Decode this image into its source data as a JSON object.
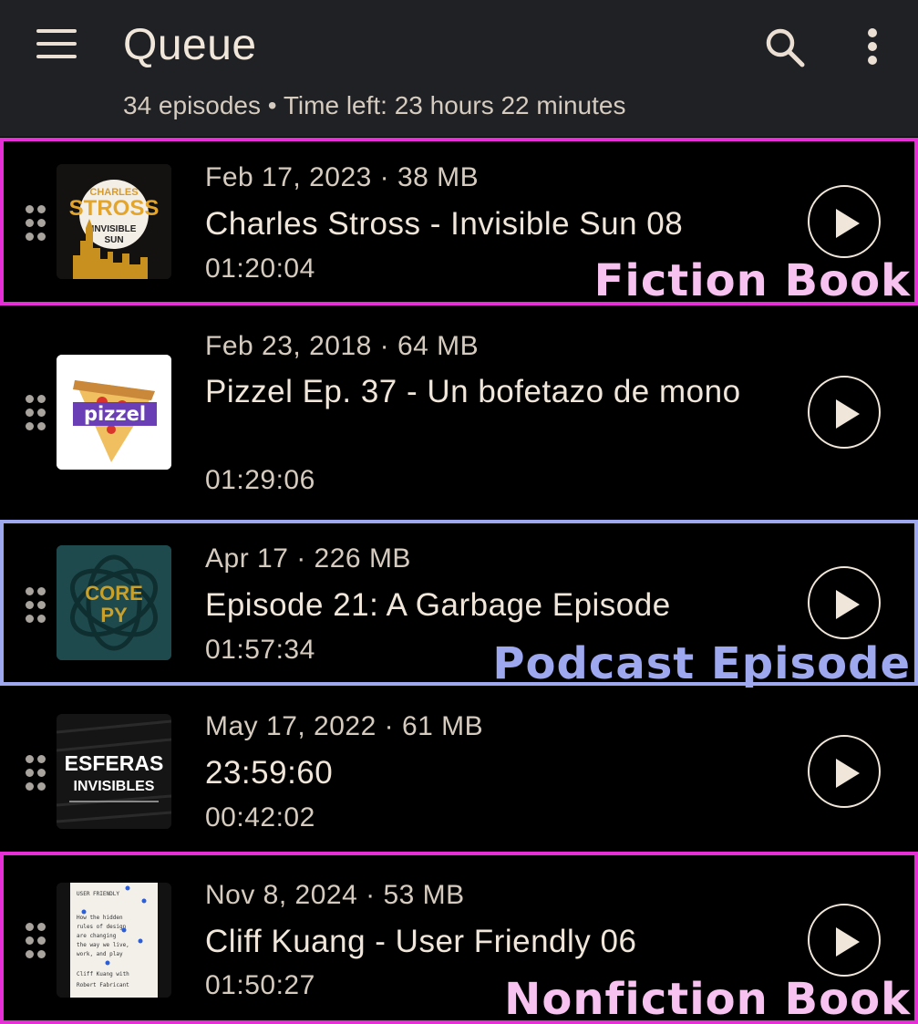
{
  "header": {
    "title": "Queue",
    "summary": "34 episodes • Time left: 23 hours 22 minutes"
  },
  "icons": {
    "menu": "hamburger-menu-icon",
    "search": "search-icon",
    "more": "more-vertical-icon",
    "drag": "drag-handle-icon",
    "play": "play-icon"
  },
  "episodes": [
    {
      "meta": "Feb 17, 2023 · 38 MB",
      "title": "Charles Stross - Invisible Sun 08",
      "duration": "01:20:04",
      "cover_text": [
        "CHARLES",
        "STROSS",
        "INVISIBLE",
        "SUN"
      ],
      "label": "Fiction Book",
      "label_color": "#f7c2f0",
      "frame_color": "#e62fd6"
    },
    {
      "meta": "Feb 23, 2018 · 64 MB",
      "title": "Pizzel Ep. 37 - Un bofetazo de mono",
      "duration": "01:29:06",
      "cover_text": [
        "pizzel"
      ]
    },
    {
      "meta": "Apr 17 · 226 MB",
      "title": "Episode 21: A Garbage Episode",
      "duration": "01:57:34",
      "cover_text": [
        "CORE",
        "PY"
      ],
      "label": "Podcast Episode",
      "label_color": "#9ea8ef",
      "frame_color": "#9ea8ef"
    },
    {
      "meta": "May 17, 2022 · 61 MB",
      "title": "23:59:60",
      "duration": "00:42:02",
      "cover_text": [
        "ESFERAS",
        "INVISIBLES"
      ]
    },
    {
      "meta": "Nov 8, 2024 · 53 MB",
      "title": "Cliff Kuang - User Friendly 06",
      "duration": "01:50:27",
      "cover_text": [
        "USER FRIENDLY",
        "How the hidden",
        "rules of design",
        "are changing",
        "the way we live,",
        "work, and play",
        "Cliff Kuang with",
        "Robert Fabricant"
      ],
      "label": "Nonfiction Book",
      "label_color": "#f7c2f0",
      "frame_color": "#e62fd6"
    }
  ]
}
